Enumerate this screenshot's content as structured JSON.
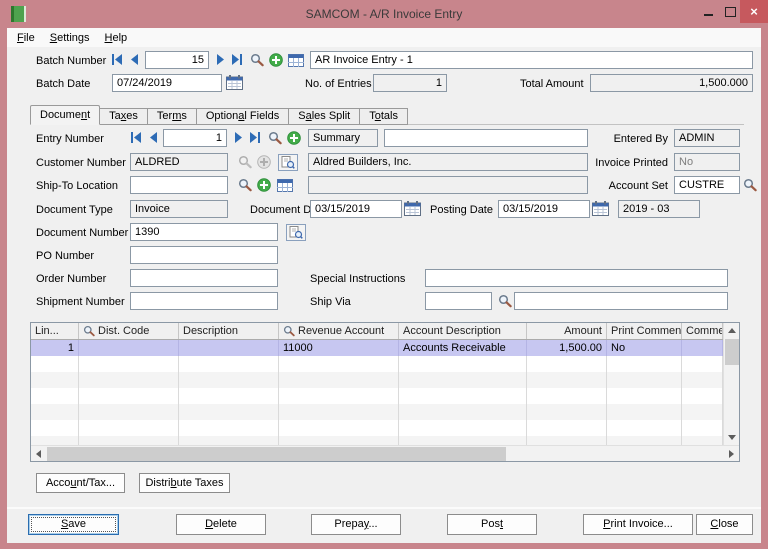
{
  "window": {
    "title": "SAMCOM - A/R Invoice Entry"
  },
  "menu": {
    "items": [
      {
        "label": "File"
      },
      {
        "label": "Settings"
      },
      {
        "label": "Help"
      }
    ]
  },
  "batch_header": {
    "batch_number": {
      "label": "Batch Number",
      "value": "15",
      "description": "AR Invoice Entry - 1"
    },
    "batch_date": {
      "label": "Batch Date",
      "value": "07/24/2019"
    },
    "no_of_entries": {
      "label": "No. of Entries",
      "value": "1"
    },
    "total_amount": {
      "label": "Total Amount",
      "value": "1,500.000"
    }
  },
  "tabs": {
    "active": "Document",
    "items": [
      {
        "label": "Document"
      },
      {
        "label": "Taxes"
      },
      {
        "label": "Terms"
      },
      {
        "label": "Optional Fields"
      },
      {
        "label": "Sales Split"
      },
      {
        "label": "Totals"
      }
    ]
  },
  "document_tab": {
    "entry_number": {
      "label": "Entry Number",
      "value": "1"
    },
    "entry_type": {
      "value": "Summary"
    },
    "entry_description": {
      "value": ""
    },
    "entered_by": {
      "label": "Entered By",
      "value": "ADMIN"
    },
    "customer_number": {
      "label": "Customer Number",
      "value": "ALDRED",
      "name": "Aldred Builders, Inc."
    },
    "invoice_printed": {
      "label": "Invoice Printed",
      "value": "No"
    },
    "ship_to_location": {
      "label": "Ship-To Location",
      "value": "",
      "description": ""
    },
    "account_set": {
      "label": "Account Set",
      "value": "CUSTRE"
    },
    "document_type": {
      "label": "Document Type",
      "value": "Invoice"
    },
    "document_date": {
      "label": "Document Date",
      "value": "03/15/2019"
    },
    "posting_date": {
      "label": "Posting Date",
      "value": "03/15/2019"
    },
    "fiscal_period": {
      "value": "2019 - 03"
    },
    "document_number": {
      "label": "Document Number",
      "value": "1390"
    },
    "po_number": {
      "label": "PO Number",
      "value": ""
    },
    "order_number": {
      "label": "Order Number",
      "value": ""
    },
    "special_instructions": {
      "label": "Special Instructions",
      "value": ""
    },
    "shipment_number": {
      "label": "Shipment Number",
      "value": ""
    },
    "ship_via": {
      "label": "Ship Via",
      "code": "",
      "description": ""
    }
  },
  "grid": {
    "columns": [
      "Lin...",
      "Dist. Code",
      "Description",
      "Revenue Account",
      "Account Description",
      "Amount",
      "Print Comment",
      "Commen"
    ],
    "rows": [
      {
        "line": "1",
        "dist_code": "",
        "description": "",
        "revenue_account": "11000",
        "account_description": "Accounts Receivable",
        "amount": "1,500.00",
        "print_comment": "No",
        "comment": ""
      }
    ]
  },
  "detail_buttons": {
    "account_tax": {
      "label": "Account/Tax..."
    },
    "distribute_taxes": {
      "label": "Distribute Taxes"
    }
  },
  "footer_buttons": {
    "save": {
      "label": "Save"
    },
    "delete": {
      "label": "Delete"
    },
    "prepay": {
      "label": "Prepay..."
    },
    "post": {
      "label": "Post"
    },
    "print_invoice": {
      "label": "Print Invoice..."
    },
    "close": {
      "label": "Close"
    }
  },
  "colors": {
    "titlebar": "#c8858c",
    "close_button": "#c6595e",
    "selected_row": "#c7c7f1",
    "nav_arrow_blue": "#2d6bb5",
    "new_button_green": "#43ad49",
    "window_background": "#f0f0f0"
  }
}
